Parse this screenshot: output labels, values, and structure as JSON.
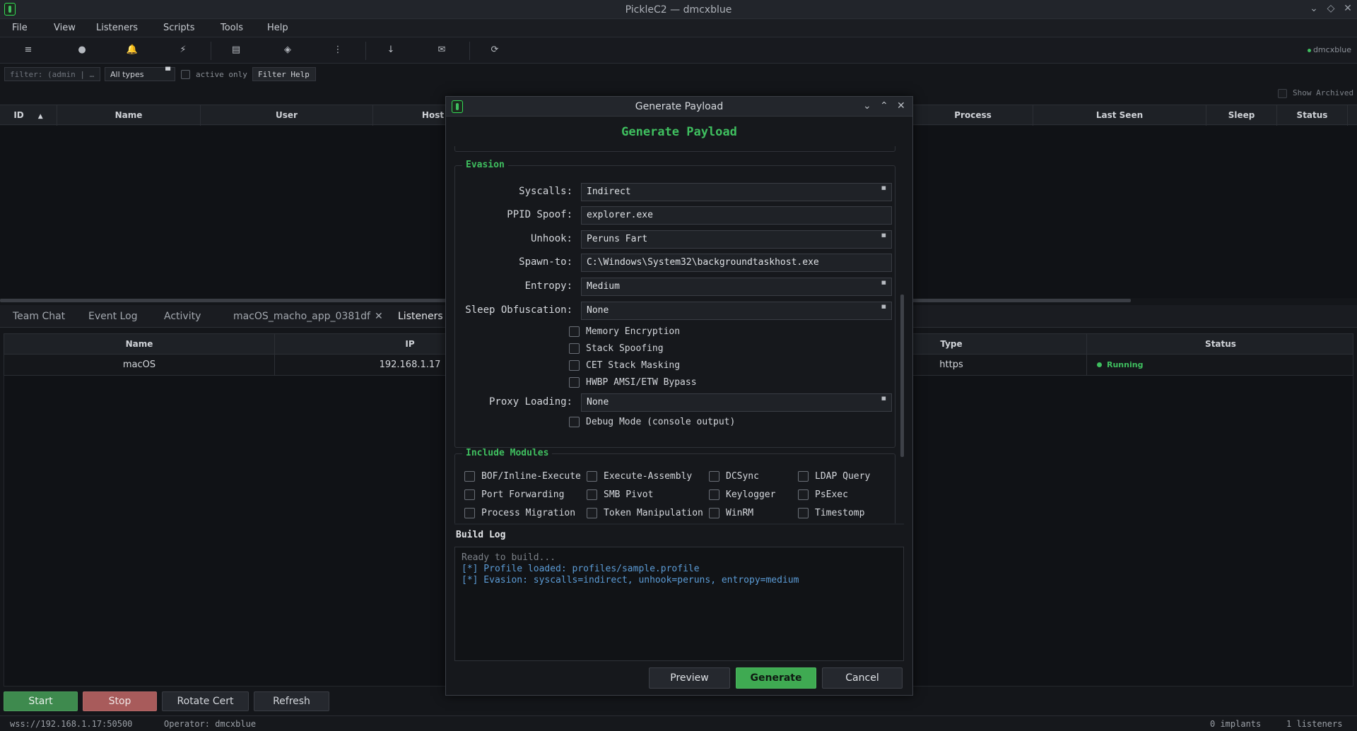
{
  "window": {
    "title": "PickleC2 — dmcxblue",
    "controls": [
      "⌄",
      "◇",
      "✕"
    ]
  },
  "menu": [
    "File",
    "View",
    "Listeners",
    "Scripts",
    "Tools",
    "Help"
  ],
  "toolbar": {
    "icons": [
      "≡",
      "●",
      "🔔",
      "⚡",
      "▤",
      "◈",
      "⋮",
      "↓",
      "✉",
      "⟳"
    ],
    "operator": "dmcxblue"
  },
  "filter": {
    "placeholder": "filter: (admin | …",
    "type_select": "All types",
    "active_only": "active only",
    "help": "Filter Help",
    "show_archived": "Show Archived"
  },
  "implants_table": {
    "columns": [
      "ID",
      "Name",
      "User",
      "Host",
      "Process",
      "Last Seen",
      "Sleep",
      "Status"
    ],
    "sort_arrow": "▲"
  },
  "tabs": [
    "Team Chat",
    "Event Log",
    "Activity",
    "macOS_macho_app_0381df",
    "✕",
    "Listeners"
  ],
  "listeners_table": {
    "columns": [
      "Name",
      "IP",
      "Type",
      "Status"
    ],
    "rows": [
      {
        "name": "macOS",
        "ip": "192.168.1.17",
        "type": "https",
        "status": "Running",
        "status_color": "#3fbf5f"
      }
    ]
  },
  "listener_buttons": {
    "start": "Start",
    "stop": "Stop",
    "rotate": "Rotate Cert",
    "refresh": "Refresh"
  },
  "statusbar": {
    "server": "wss://192.168.1.17:50500",
    "operator": "Operator: dmcxblue",
    "implants": "0 implants",
    "listeners": "1 listeners"
  },
  "dialog": {
    "window_title": "Generate Payload",
    "controls": [
      "⌄",
      "⌃",
      "✕"
    ],
    "heading": "Generate Payload",
    "evasion": {
      "title": "Evasion",
      "syscalls_label": "Syscalls:",
      "syscalls": "Indirect",
      "ppid_label": "PPID Spoof:",
      "ppid": "explorer.exe",
      "unhook_label": "Unhook:",
      "unhook": "Peruns Fart",
      "spawn_label": "Spawn-to:",
      "spawn": "C:\\Windows\\System32\\backgroundtaskhost.exe",
      "entropy_label": "Entropy:",
      "entropy": "Medium",
      "sleep_label": "Sleep Obfuscation:",
      "sleep": "None",
      "checks": [
        "Memory Encryption",
        "Stack Spoofing",
        "CET Stack Masking",
        "HWBP AMSI/ETW Bypass"
      ],
      "proxy_label": "Proxy Loading:",
      "proxy": "None",
      "debug": "Debug Mode (console output)"
    },
    "modules": {
      "title": "Include Modules",
      "items": [
        "BOF/Inline-Execute",
        "Execute-Assembly",
        "DCSync",
        "LDAP Query",
        "Port Forwarding",
        "SMB Pivot",
        "Keylogger",
        "PsExec",
        "Process Migration",
        "Token Manipulation",
        "WinRM",
        "Timestomp"
      ]
    },
    "build_log": {
      "label": "Build Log",
      "lines": [
        "Ready to build...",
        "[*] Profile loaded: profiles/sample.profile",
        "[*] Evasion: syscalls=indirect, unhook=peruns, entropy=medium"
      ]
    },
    "buttons": {
      "preview": "Preview",
      "generate": "Generate",
      "cancel": "Cancel"
    }
  },
  "colors": {
    "accent": "#3fbf5f",
    "stop": "#a85b5b",
    "log_info": "#5b9bd5"
  }
}
